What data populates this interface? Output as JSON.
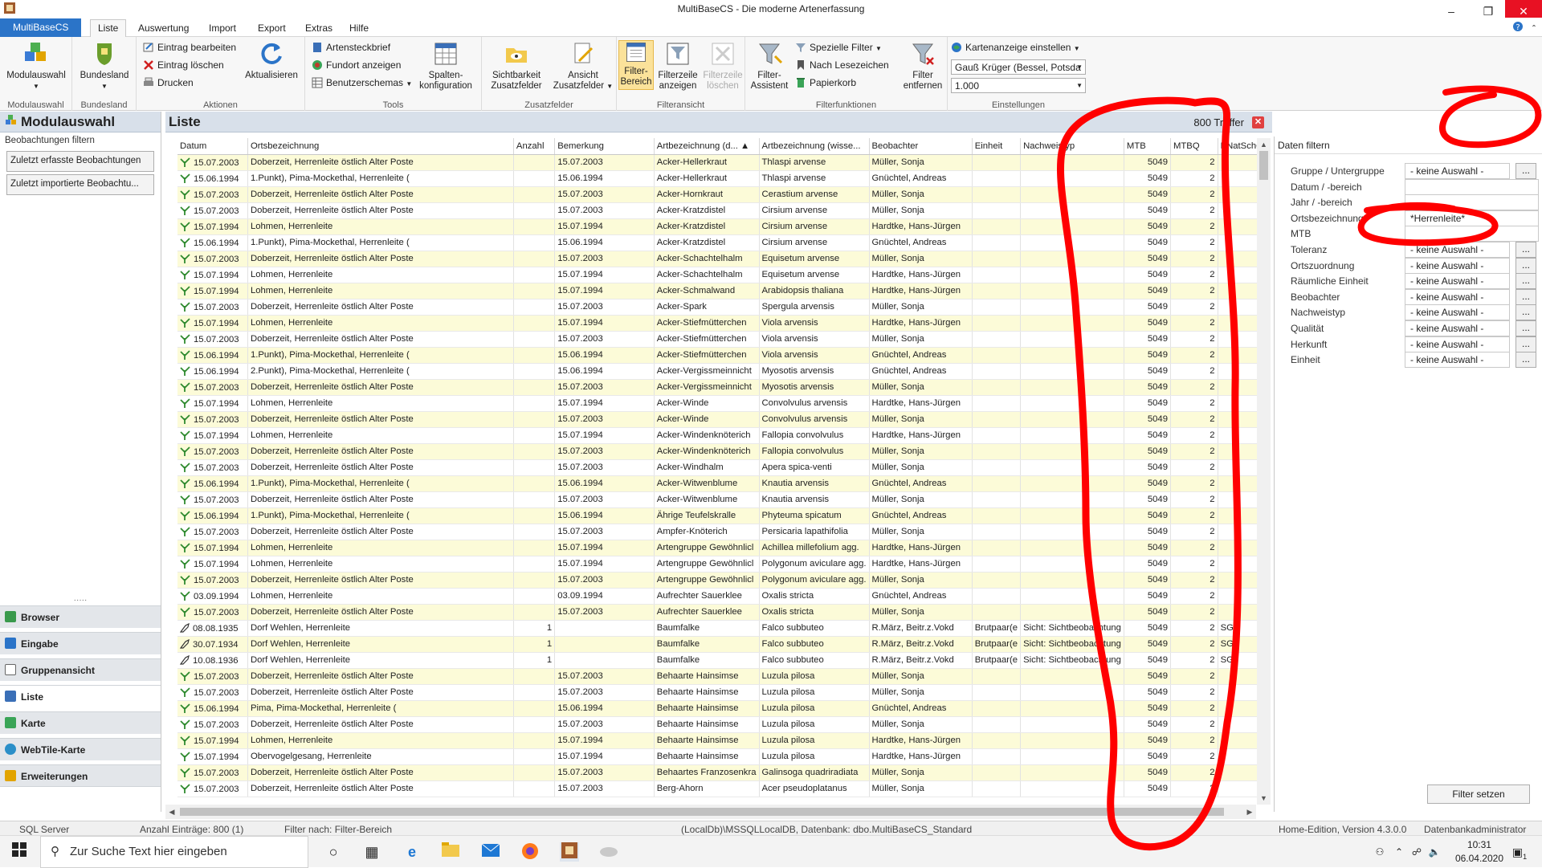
{
  "window": {
    "title": "MultiBaseCS - Die moderne Artenerfassung"
  },
  "menu": {
    "app_tab": "MultiBaseCS",
    "tabs": [
      "Liste",
      "Auswertung",
      "Import",
      "Export",
      "Extras",
      "Hilfe"
    ]
  },
  "ribbon": {
    "modulauswahl": {
      "label": "Modulauswahl",
      "group": "Modulauswahl"
    },
    "bundesland": {
      "label": "Bundesland",
      "group": "Bundesland"
    },
    "aktionen": {
      "group": "Aktionen",
      "edit": "Eintrag bearbeiten",
      "delete": "Eintrag löschen",
      "print": "Drucken",
      "refresh": "Aktualisieren"
    },
    "tools": {
      "group": "Tools",
      "artensteckbrief": "Artensteckbrief",
      "fundort": "Fundort anzeigen",
      "schemas": "Benutzerschemas",
      "spalten1": "Spalten-",
      "spalten2": "konfiguration"
    },
    "zusatzfelder": {
      "group": "Zusatzfelder",
      "sicht1": "Sichtbarkeit",
      "sicht2": "Zusatzfelder",
      "ansicht1": "Ansicht",
      "ansicht2": "Zusatzfelder"
    },
    "filteransicht": {
      "group": "Filteransicht",
      "fb1": "Filter-",
      "fb2": "Bereich",
      "fz1": "Filterzeile",
      "fz2": "anzeigen",
      "fl1": "Filterzeile",
      "fl2": "löschen"
    },
    "filterfunktionen": {
      "group": "Filterfunktionen",
      "assistent1": "Filter-",
      "assistent2": "Assistent",
      "spezielle": "Spezielle Filter",
      "lesezeichen": "Nach Lesezeichen",
      "papierkorb": "Papierkorb",
      "entfernen1": "Filter",
      "entfernen2": "entfernen"
    },
    "einstellungen": {
      "group": "Einstellungen",
      "karte": "Kartenanzeige einstellen",
      "projection": "Gauß Krüger (Bessel, Potsda",
      "scale": "1.000"
    }
  },
  "left": {
    "title": "Modulauswahl",
    "subtitle": "Beobachtungen filtern",
    "btn_recent": "Zuletzt erfasste Beobachtungen",
    "btn_imported": "Zuletzt  importierte Beobachtu...",
    "nav": [
      "Browser",
      "Eingabe",
      "Gruppenansicht",
      "Liste",
      "Karte",
      "WebTile-Karte",
      "Erweiterungen"
    ]
  },
  "list": {
    "title": "Liste",
    "treffer": "800 Treffer",
    "columns": [
      "Datum",
      "Ortsbezeichnung",
      "Anzahl",
      "Bemerkung",
      "Artbezeichnung (d... ▲",
      "Artbezeichnung (wisse...",
      "Beobachter",
      "Einheit",
      "Nachweistyp",
      "MTB",
      "MTBQ",
      "BNatSchG"
    ],
    "rows": [
      [
        "15.07.2003",
        "Doberzeit, Herrenleite östlich Alter Poste",
        "",
        "15.07.2003",
        "Acker-Hellerkraut",
        "Thlaspi arvense",
        "Müller, Sonja",
        "",
        "",
        "5049",
        "2",
        ""
      ],
      [
        "15.06.1994",
        "1.Punkt), Pima-Mockethal, Herrenleite (",
        "",
        "15.06.1994",
        "Acker-Hellerkraut",
        "Thlaspi arvense",
        "Gnüchtel, Andreas",
        "",
        "",
        "5049",
        "2",
        ""
      ],
      [
        "15.07.2003",
        "Doberzeit, Herrenleite östlich Alter Poste",
        "",
        "15.07.2003",
        "Acker-Hornkraut",
        "Cerastium arvense",
        "Müller, Sonja",
        "",
        "",
        "5049",
        "2",
        ""
      ],
      [
        "15.07.2003",
        "Doberzeit, Herrenleite östlich Alter Poste",
        "",
        "15.07.2003",
        "Acker-Kratzdistel",
        "Cirsium arvense",
        "Müller, Sonja",
        "",
        "",
        "5049",
        "2",
        ""
      ],
      [
        "15.07.1994",
        "Lohmen, Herrenleite",
        "",
        "15.07.1994",
        "Acker-Kratzdistel",
        "Cirsium arvense",
        "Hardtke, Hans-Jürgen",
        "",
        "",
        "5049",
        "2",
        ""
      ],
      [
        "15.06.1994",
        "1.Punkt), Pima-Mockethal, Herrenleite (",
        "",
        "15.06.1994",
        "Acker-Kratzdistel",
        "Cirsium arvense",
        "Gnüchtel, Andreas",
        "",
        "",
        "5049",
        "2",
        ""
      ],
      [
        "15.07.2003",
        "Doberzeit, Herrenleite östlich Alter Poste",
        "",
        "15.07.2003",
        "Acker-Schachtelhalm",
        "Equisetum arvense",
        "Müller, Sonja",
        "",
        "",
        "5049",
        "2",
        ""
      ],
      [
        "15.07.1994",
        "Lohmen, Herrenleite",
        "",
        "15.07.1994",
        "Acker-Schachtelhalm",
        "Equisetum arvense",
        "Hardtke, Hans-Jürgen",
        "",
        "",
        "5049",
        "2",
        ""
      ],
      [
        "15.07.1994",
        "Lohmen, Herrenleite",
        "",
        "15.07.1994",
        "Acker-Schmalwand",
        "Arabidopsis thaliana",
        "Hardtke, Hans-Jürgen",
        "",
        "",
        "5049",
        "2",
        ""
      ],
      [
        "15.07.2003",
        "Doberzeit, Herrenleite östlich Alter Poste",
        "",
        "15.07.2003",
        "Acker-Spark",
        "Spergula arvensis",
        "Müller, Sonja",
        "",
        "",
        "5049",
        "2",
        ""
      ],
      [
        "15.07.1994",
        "Lohmen, Herrenleite",
        "",
        "15.07.1994",
        "Acker-Stiefmütterchen",
        "Viola arvensis",
        "Hardtke, Hans-Jürgen",
        "",
        "",
        "5049",
        "2",
        ""
      ],
      [
        "15.07.2003",
        "Doberzeit, Herrenleite östlich Alter Poste",
        "",
        "15.07.2003",
        "Acker-Stiefmütterchen",
        "Viola arvensis",
        "Müller, Sonja",
        "",
        "",
        "5049",
        "2",
        ""
      ],
      [
        "15.06.1994",
        "1.Punkt), Pima-Mockethal, Herrenleite (",
        "",
        "15.06.1994",
        "Acker-Stiefmütterchen",
        "Viola arvensis",
        "Gnüchtel, Andreas",
        "",
        "",
        "5049",
        "2",
        ""
      ],
      [
        "15.06.1994",
        "2.Punkt), Pima-Mockethal, Herrenleite (",
        "",
        "15.06.1994",
        "Acker-Vergissmeinnicht",
        "Myosotis arvensis",
        "Gnüchtel, Andreas",
        "",
        "",
        "5049",
        "2",
        ""
      ],
      [
        "15.07.2003",
        "Doberzeit, Herrenleite östlich Alter Poste",
        "",
        "15.07.2003",
        "Acker-Vergissmeinnicht",
        "Myosotis arvensis",
        "Müller, Sonja",
        "",
        "",
        "5049",
        "2",
        ""
      ],
      [
        "15.07.1994",
        "Lohmen, Herrenleite",
        "",
        "15.07.1994",
        "Acker-Winde",
        "Convolvulus arvensis",
        "Hardtke, Hans-Jürgen",
        "",
        "",
        "5049",
        "2",
        ""
      ],
      [
        "15.07.2003",
        "Doberzeit, Herrenleite östlich Alter Poste",
        "",
        "15.07.2003",
        "Acker-Winde",
        "Convolvulus arvensis",
        "Müller, Sonja",
        "",
        "",
        "5049",
        "2",
        ""
      ],
      [
        "15.07.1994",
        "Lohmen, Herrenleite",
        "",
        "15.07.1994",
        "Acker-Windenknöterich",
        "Fallopia convolvulus",
        "Hardtke, Hans-Jürgen",
        "",
        "",
        "5049",
        "2",
        ""
      ],
      [
        "15.07.2003",
        "Doberzeit, Herrenleite östlich Alter Poste",
        "",
        "15.07.2003",
        "Acker-Windenknöterich",
        "Fallopia convolvulus",
        "Müller, Sonja",
        "",
        "",
        "5049",
        "2",
        ""
      ],
      [
        "15.07.2003",
        "Doberzeit, Herrenleite östlich Alter Poste",
        "",
        "15.07.2003",
        "Acker-Windhalm",
        "Apera spica-venti",
        "Müller, Sonja",
        "",
        "",
        "5049",
        "2",
        ""
      ],
      [
        "15.06.1994",
        "1.Punkt), Pima-Mockethal, Herrenleite (",
        "",
        "15.06.1994",
        "Acker-Witwenblume",
        "Knautia arvensis",
        "Gnüchtel, Andreas",
        "",
        "",
        "5049",
        "2",
        ""
      ],
      [
        "15.07.2003",
        "Doberzeit, Herrenleite östlich Alter Poste",
        "",
        "15.07.2003",
        "Acker-Witwenblume",
        "Knautia arvensis",
        "Müller, Sonja",
        "",
        "",
        "5049",
        "2",
        ""
      ],
      [
        "15.06.1994",
        "1.Punkt), Pima-Mockethal, Herrenleite (",
        "",
        "15.06.1994",
        "Ährige Teufelskralle",
        "Phyteuma spicatum",
        "Gnüchtel, Andreas",
        "",
        "",
        "5049",
        "2",
        ""
      ],
      [
        "15.07.2003",
        "Doberzeit, Herrenleite östlich Alter Poste",
        "",
        "15.07.2003",
        "Ampfer-Knöterich",
        "Persicaria lapathifolia",
        "Müller, Sonja",
        "",
        "",
        "5049",
        "2",
        ""
      ],
      [
        "15.07.1994",
        "Lohmen, Herrenleite",
        "",
        "15.07.1994",
        "Artengruppe Gewöhnlicl",
        "Achillea millefolium agg.",
        "Hardtke, Hans-Jürgen",
        "",
        "",
        "5049",
        "2",
        ""
      ],
      [
        "15.07.1994",
        "Lohmen, Herrenleite",
        "",
        "15.07.1994",
        "Artengruppe Gewöhnlicl",
        "Polygonum aviculare agg.",
        "Hardtke, Hans-Jürgen",
        "",
        "",
        "5049",
        "2",
        ""
      ],
      [
        "15.07.2003",
        "Doberzeit, Herrenleite östlich Alter Poste",
        "",
        "15.07.2003",
        "Artengruppe Gewöhnlicl",
        "Polygonum aviculare agg.",
        "Müller, Sonja",
        "",
        "",
        "5049",
        "2",
        ""
      ],
      [
        "03.09.1994",
        "Lohmen, Herrenleite",
        "",
        "03.09.1994",
        "Aufrechter Sauerklee",
        "Oxalis stricta",
        "Gnüchtel, Andreas",
        "",
        "",
        "5049",
        "2",
        ""
      ],
      [
        "15.07.2003",
        "Doberzeit, Herrenleite östlich Alter Poste",
        "",
        "15.07.2003",
        "Aufrechter Sauerklee",
        "Oxalis stricta",
        "Müller, Sonja",
        "",
        "",
        "5049",
        "2",
        ""
      ],
      [
        "08.08.1935",
        "Dorf Wehlen, Herrenleite",
        "1",
        "",
        "Baumfalke",
        "Falco subbuteo",
        "R.März, Beitr.z.Vokd",
        "Brutpaar(e",
        "Sicht: Sichtbeobachtung",
        "5049",
        "2",
        "SG"
      ],
      [
        "30.07.1934",
        "Dorf Wehlen, Herrenleite",
        "1",
        "",
        "Baumfalke",
        "Falco subbuteo",
        "R.März, Beitr.z.Vokd",
        "Brutpaar(e",
        "Sicht: Sichtbeobachtung",
        "5049",
        "2",
        "SG"
      ],
      [
        "10.08.1936",
        "Dorf Wehlen, Herrenleite",
        "1",
        "",
        "Baumfalke",
        "Falco subbuteo",
        "R.März, Beitr.z.Vokd",
        "Brutpaar(e",
        "Sicht: Sichtbeobachtung",
        "5049",
        "2",
        "SG"
      ],
      [
        "15.07.2003",
        "Doberzeit, Herrenleite östlich Alter Poste",
        "",
        "15.07.2003",
        "Behaarte Hainsimse",
        "Luzula pilosa",
        "Müller, Sonja",
        "",
        "",
        "5049",
        "2",
        ""
      ],
      [
        "15.07.2003",
        "Doberzeit, Herrenleite östlich Alter Poste",
        "",
        "15.07.2003",
        "Behaarte Hainsimse",
        "Luzula pilosa",
        "Müller, Sonja",
        "",
        "",
        "5049",
        "2",
        ""
      ],
      [
        "15.06.1994",
        "Pima, Pima-Mockethal, Herrenleite (",
        "",
        "15.06.1994",
        "Behaarte Hainsimse",
        "Luzula pilosa",
        "Gnüchtel, Andreas",
        "",
        "",
        "5049",
        "2",
        ""
      ],
      [
        "15.07.2003",
        "Doberzeit, Herrenleite östlich Alter Poste",
        "",
        "15.07.2003",
        "Behaarte Hainsimse",
        "Luzula pilosa",
        "Müller, Sonja",
        "",
        "",
        "5049",
        "2",
        ""
      ],
      [
        "15.07.1994",
        "Lohmen, Herrenleite",
        "",
        "15.07.1994",
        "Behaarte Hainsimse",
        "Luzula pilosa",
        "Hardtke, Hans-Jürgen",
        "",
        "",
        "5049",
        "2",
        ""
      ],
      [
        "15.07.1994",
        "Obervogelgesang, Herrenleite",
        "",
        "15.07.1994",
        "Behaarte Hainsimse",
        "Luzula pilosa",
        "Hardtke, Hans-Jürgen",
        "",
        "",
        "5049",
        "2",
        ""
      ],
      [
        "15.07.2003",
        "Doberzeit, Herrenleite östlich Alter Poste",
        "",
        "15.07.2003",
        "Behaartes Franzosenkra",
        "Galinsoga quadriradiata",
        "Müller, Sonja",
        "",
        "",
        "5049",
        "2",
        ""
      ],
      [
        "15.07.2003",
        "Doberzeit, Herrenleite östlich Alter Poste",
        "",
        "15.07.2003",
        "Berg-Ahorn",
        "Acer pseudoplatanus",
        "Müller, Sonja",
        "",
        "",
        "5049",
        "2",
        ""
      ]
    ]
  },
  "filter": {
    "title": "Daten filtern",
    "fields": [
      {
        "label": "Gruppe / Untergruppe",
        "value": "- keine Auswahl -",
        "button": "..."
      },
      {
        "label": "Datum / -bereich",
        "value": ""
      },
      {
        "label": "Jahr / -bereich",
        "value": ""
      },
      {
        "label": "Ortsbezeichnung",
        "value": "*Herrenleite*"
      },
      {
        "label": "MTB",
        "value": ""
      },
      {
        "label": "Toleranz",
        "value": "- keine Auswahl -",
        "button": "..."
      },
      {
        "label": "Ortszuordnung",
        "value": "- keine Auswahl -",
        "button": "..."
      },
      {
        "label": "Räumliche Einheit",
        "value": "- keine Auswahl -",
        "button": "..."
      },
      {
        "label": "Beobachter",
        "value": "- keine Auswahl -",
        "button": "..."
      },
      {
        "label": "Nachweistyp",
        "value": "- keine Auswahl -",
        "button": "..."
      },
      {
        "label": "Qualität",
        "value": "- keine Auswahl -",
        "button": "..."
      },
      {
        "label": "Herkunft",
        "value": "- keine Auswahl -",
        "button": "..."
      },
      {
        "label": "Einheit",
        "value": "- keine Auswahl -",
        "button": "..."
      }
    ],
    "apply": "Filter setzen"
  },
  "status": {
    "server": "SQL Server",
    "count": "Anzahl Einträge: 800 (1)",
    "filter": "Filter nach: Filter-Bereich",
    "db": "(LocalDb)\\MSSQLLocalDB, Datenbank: dbo.MultiBaseCS_Standard",
    "edition": "Home-Edition, Version 4.3.0.0",
    "role": "Datenbankadministrator"
  },
  "taskbar": {
    "search_placeholder": "Zur Suche Text hier eingeben",
    "time": "10:31",
    "date": "06.04.2020",
    "notifications": "1"
  },
  "colors": {
    "accent": "#2b74c8",
    "alt_row": "#fcfbd8",
    "panel_header": "#d8e0ea",
    "annotation_red": "#ff0000"
  }
}
